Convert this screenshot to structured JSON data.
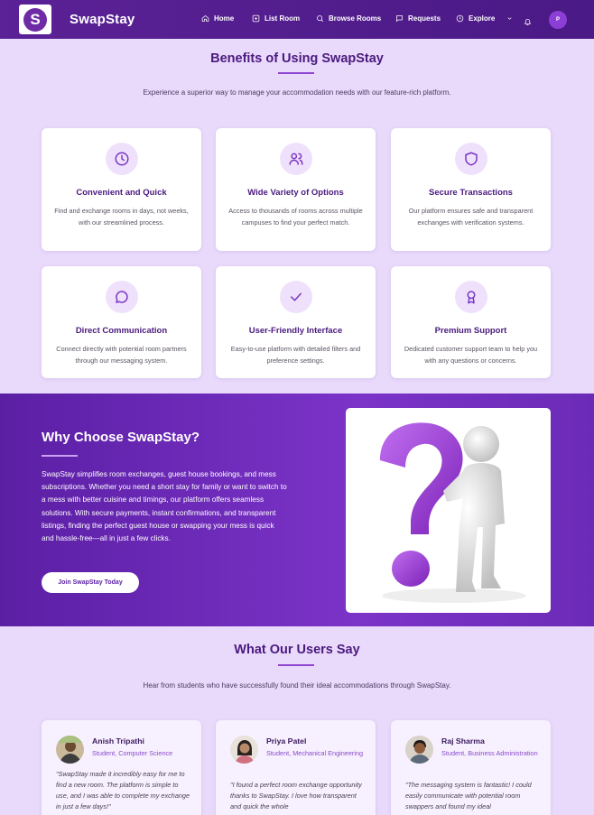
{
  "nav": {
    "logo_letter": "S",
    "brand": "SwapStay",
    "links": [
      "Home",
      "List Room",
      "Browse Rooms",
      "Requests",
      "Explore"
    ],
    "avatar_initial": "P"
  },
  "benefits": {
    "title": "Benefits of Using SwapStay",
    "subtitle": "Experience a superior way to manage your accommodation needs with our feature-rich platform.",
    "cards": [
      {
        "icon": "clock-icon",
        "title": "Convenient and Quick",
        "desc": "Find and exchange rooms in days, not weeks, with our streamlined process."
      },
      {
        "icon": "users-icon",
        "title": "Wide Variety of Options",
        "desc": "Access to thousands of rooms across multiple campuses to find your perfect match."
      },
      {
        "icon": "shield-icon",
        "title": "Secure Transactions",
        "desc": "Our platform ensures safe and transparent exchanges with verification systems."
      },
      {
        "icon": "chat-icon",
        "title": "Direct Communication",
        "desc": "Connect directly with potential room partners through our messaging system."
      },
      {
        "icon": "check-icon",
        "title": "User-Friendly Interface",
        "desc": "Easy-to-use platform with detailed filters and preference settings."
      },
      {
        "icon": "award-icon",
        "title": "Premium Support",
        "desc": "Dedicated customer support team to help you with any questions or concerns."
      }
    ]
  },
  "why": {
    "title": "Why Choose SwapStay?",
    "text": "SwapStay simplifies room exchanges, guest house bookings, and mess subscriptions. Whether you need a short stay for family or want to switch to a mess with better cuisine and timings, our platform offers seamless solutions. With secure payments, instant confirmations, and transparent listings, finding the perfect guest house or swapping your mess is quick and hassle-free—all in just a few clicks.",
    "button": "Join SwapStay Today"
  },
  "testimonials": {
    "title": "What Our Users Say",
    "subtitle": "Hear from students who have successfully found their ideal accommodations through SwapStay.",
    "items": [
      {
        "name": "Anish Tripathi",
        "role": "Student, Computer Science",
        "quote": "\"SwapStay made it incredibly easy for me to find a new room. The platform is simple to use, and I was able to complete my exchange in just a few days!\""
      },
      {
        "name": "Priya Patel",
        "role": "Student, Mechanical Engineering",
        "quote": "\"I found a perfect room exchange opportunity thanks to SwapStay. I love how transparent and quick the whole"
      },
      {
        "name": "Raj Sharma",
        "role": "Student, Business Administration",
        "quote": "\"The messaging system is fantastic! I could easily communicate with potential room swappers and found my ideal"
      }
    ]
  },
  "colors": {
    "primary": "#5b2196",
    "accent": "#8e45cf",
    "background": "#e9d9fb"
  }
}
